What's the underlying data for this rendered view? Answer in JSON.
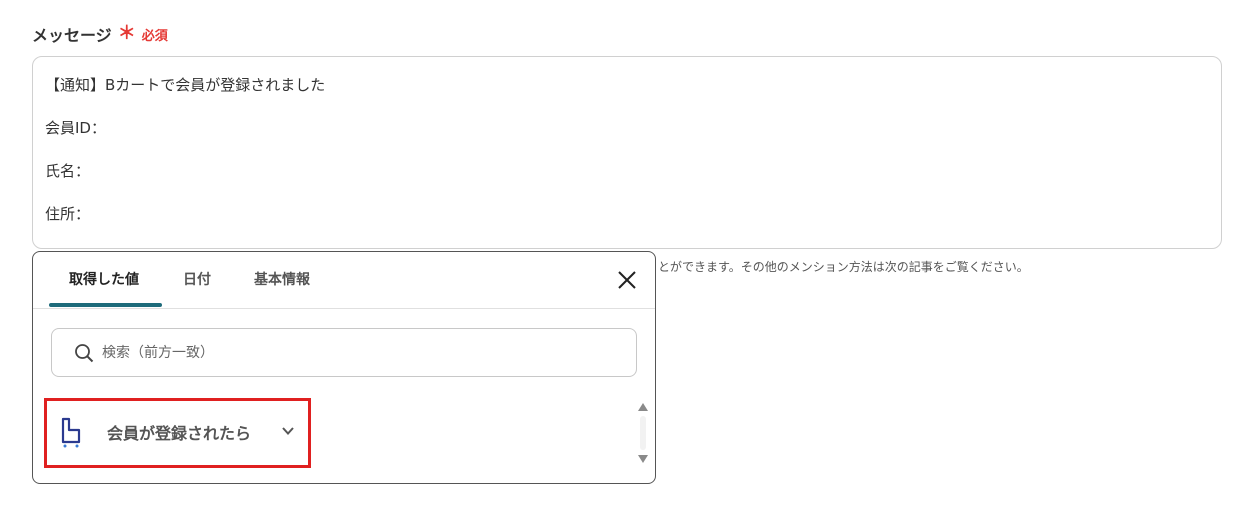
{
  "field": {
    "title": "メッセージ",
    "asterisk": "＊",
    "required": "必須"
  },
  "message": {
    "lines": [
      "【通知】Bカートで会員が登録されました",
      "会員ID：",
      "氏名：",
      "住所："
    ]
  },
  "helper_text": "とができます。その他のメンション方法は次の記事をご覧ください。",
  "popup": {
    "tabs": [
      {
        "label": "取得した値",
        "active": true
      },
      {
        "label": "日付",
        "active": false
      },
      {
        "label": "基本情報",
        "active": false
      }
    ],
    "close_icon": "close-icon",
    "search": {
      "placeholder": "検索（前方一致）",
      "value": ""
    },
    "items": [
      {
        "label": "会員が登録されたら",
        "icon": "cart-app-icon",
        "expand_icon": "chevron-down-icon"
      }
    ]
  },
  "colors": {
    "accent": "#1e6b7b",
    "required": "#e53935",
    "highlight": "#e02020",
    "cart_icon": "#2b3a8f"
  }
}
